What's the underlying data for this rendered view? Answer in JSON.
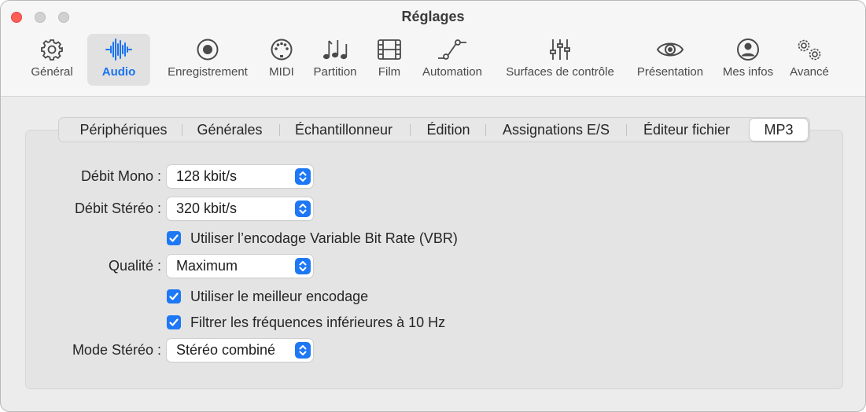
{
  "window": {
    "title": "Réglages"
  },
  "toolbar": {
    "items": [
      {
        "label": "Général",
        "icon": "gear-icon"
      },
      {
        "label": "Audio",
        "icon": "waveform-icon",
        "selected": true
      },
      {
        "label": "Enregistrement",
        "icon": "record-icon"
      },
      {
        "label": "MIDI",
        "icon": "midi-port-icon"
      },
      {
        "label": "Partition",
        "icon": "music-notes-icon"
      },
      {
        "label": "Film",
        "icon": "film-icon"
      },
      {
        "label": "Automation",
        "icon": "automation-curve-icon"
      },
      {
        "label": "Surfaces de contrôle",
        "icon": "faders-icon"
      },
      {
        "label": "Présentation",
        "icon": "eye-icon"
      },
      {
        "label": "Mes infos",
        "icon": "person-icon"
      },
      {
        "label": "Avancé",
        "icon": "gears-icon"
      }
    ]
  },
  "tabs": [
    {
      "label": "Périphériques"
    },
    {
      "label": "Générales"
    },
    {
      "label": "Échantillonneur"
    },
    {
      "label": "Édition"
    },
    {
      "label": "Assignations E/S"
    },
    {
      "label": "Éditeur fichier"
    },
    {
      "label": "MP3",
      "selected": true
    }
  ],
  "form": {
    "mono_label": "Débit Mono :",
    "mono_value": "128 kbit/s",
    "stereo_label": "Débit Stéréo :",
    "stereo_value": "320 kbit/s",
    "vbr_label": "Utiliser l’encodage Variable Bit Rate (VBR)",
    "vbr_checked": true,
    "quality_label": "Qualité :",
    "quality_value": "Maximum",
    "best_label": "Utiliser le meilleur encodage",
    "best_checked": true,
    "filter_label": "Filtrer les fréquences inférieures à 10 Hz",
    "filter_checked": true,
    "stereo_mode_label": "Mode Stéréo :",
    "stereo_mode_value": "Stéréo combiné"
  },
  "colors": {
    "accent": "#1e78f5",
    "close": "#ff5f57",
    "inactive_traffic": "#d1d1d1"
  }
}
